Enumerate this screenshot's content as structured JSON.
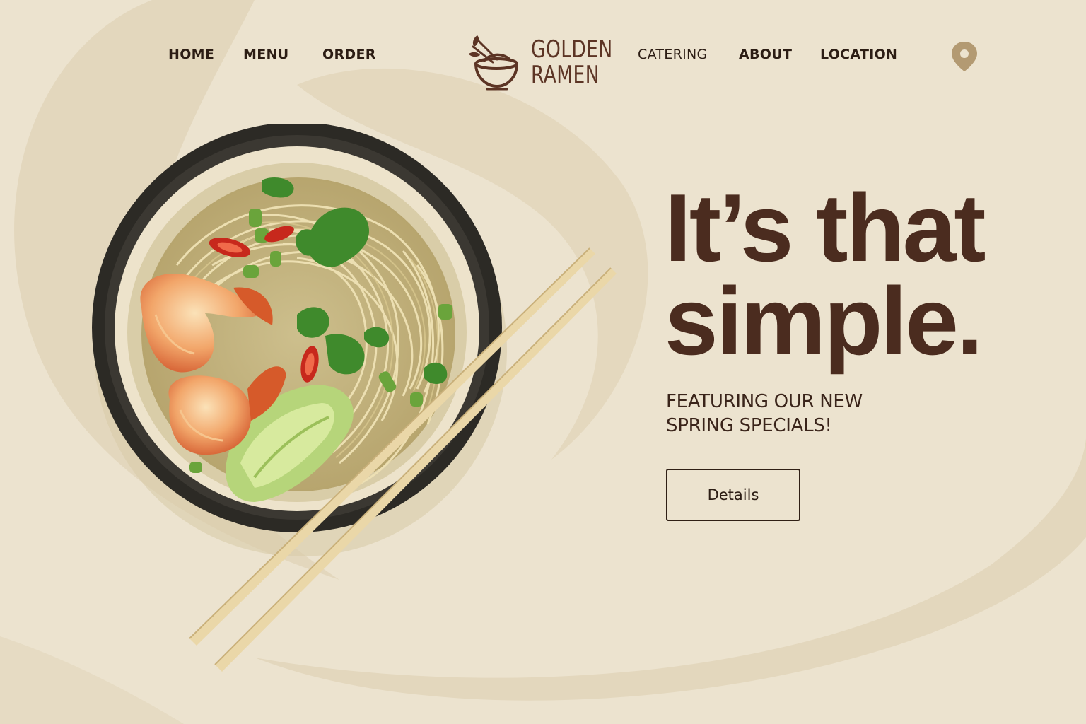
{
  "nav": {
    "items": [
      {
        "label": "HOME"
      },
      {
        "label": "MENU"
      },
      {
        "label": "ORDER"
      },
      {
        "label": "CATERING"
      },
      {
        "label": "ABOUT"
      },
      {
        "label": "LOCATION"
      }
    ]
  },
  "brand": {
    "line1": "GOLDEN",
    "line2": "RAMEN"
  },
  "hero": {
    "headline_line1": "It’s that",
    "headline_line2": "simple.",
    "subhead_line1": "FEATURING OUR NEW",
    "subhead_line2": "SPRING SPECIALS!",
    "cta_label": "Details"
  },
  "icons": {
    "location": "location-pin-icon",
    "logo": "ramen-bowl-logo-icon"
  },
  "colors": {
    "background": "#ece3cf",
    "swirl": "#e2d6bc",
    "headline": "#4b2c1f",
    "accent_pin": "#b39a72",
    "logo": "#5c3424"
  }
}
